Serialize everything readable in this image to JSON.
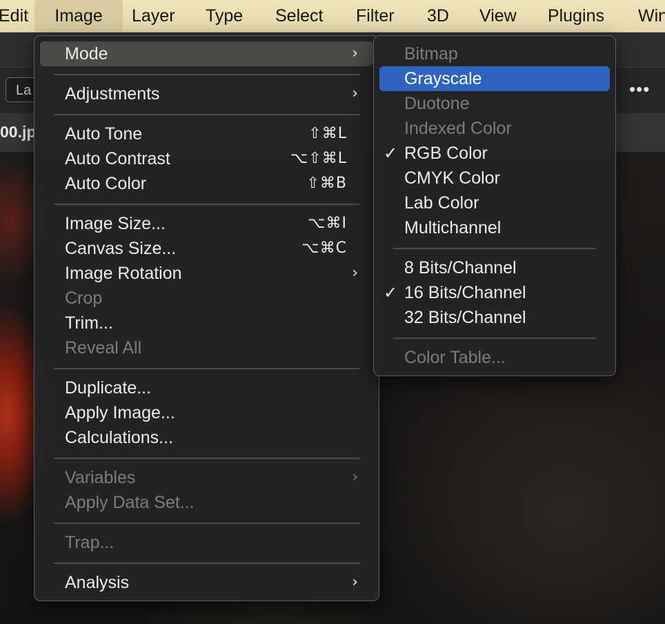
{
  "menubar": {
    "items": [
      {
        "label": "Edit"
      },
      {
        "label": "Image"
      },
      {
        "label": "Layer"
      },
      {
        "label": "Type"
      },
      {
        "label": "Select"
      },
      {
        "label": "Filter"
      },
      {
        "label": "3D"
      },
      {
        "label": "View"
      },
      {
        "label": "Plugins"
      },
      {
        "label": "Win"
      }
    ],
    "active": "Image"
  },
  "options_bar": {
    "layer_select_value": "La",
    "more_icon": "ellipsis-icon",
    "more_glyph": "•••"
  },
  "document_tab": {
    "label": "00.jp"
  },
  "image_menu": {
    "items": [
      {
        "label": "Mode",
        "arrow": "›"
      },
      {
        "label": "Adjustments",
        "arrow": "›"
      },
      {
        "label": "Auto Tone",
        "shortcut": "⇧⌘L"
      },
      {
        "label": "Auto Contrast",
        "shortcut": "⌥⇧⌘L"
      },
      {
        "label": "Auto Color",
        "shortcut": "⇧⌘B"
      },
      {
        "label": "Image Size...",
        "shortcut": "⌥⌘I"
      },
      {
        "label": "Canvas Size...",
        "shortcut": "⌥⌘C"
      },
      {
        "label": "Image Rotation",
        "arrow": "›"
      },
      {
        "label": "Crop"
      },
      {
        "label": "Trim..."
      },
      {
        "label": "Reveal All"
      },
      {
        "label": "Duplicate..."
      },
      {
        "label": "Apply Image..."
      },
      {
        "label": "Calculations..."
      },
      {
        "label": "Variables",
        "arrow": "›"
      },
      {
        "label": "Apply Data Set..."
      },
      {
        "label": "Trap..."
      },
      {
        "label": "Analysis",
        "arrow": "›"
      }
    ]
  },
  "mode_menu": {
    "check_glyph": "✓",
    "items": [
      {
        "label": "Bitmap"
      },
      {
        "label": "Grayscale"
      },
      {
        "label": "Duotone"
      },
      {
        "label": "Indexed Color"
      },
      {
        "label": "RGB Color"
      },
      {
        "label": "CMYK Color"
      },
      {
        "label": "Lab Color"
      },
      {
        "label": "Multichannel"
      },
      {
        "label": "8 Bits/Channel"
      },
      {
        "label": "16 Bits/Channel"
      },
      {
        "label": "32 Bits/Channel"
      },
      {
        "label": "Color Table..."
      }
    ]
  },
  "colors": {
    "menubar_bg": "#efe3b9",
    "menu_bg": "#242424",
    "highlight_blue": "#2f63c2",
    "disabled_text": "#7c7c7c"
  }
}
